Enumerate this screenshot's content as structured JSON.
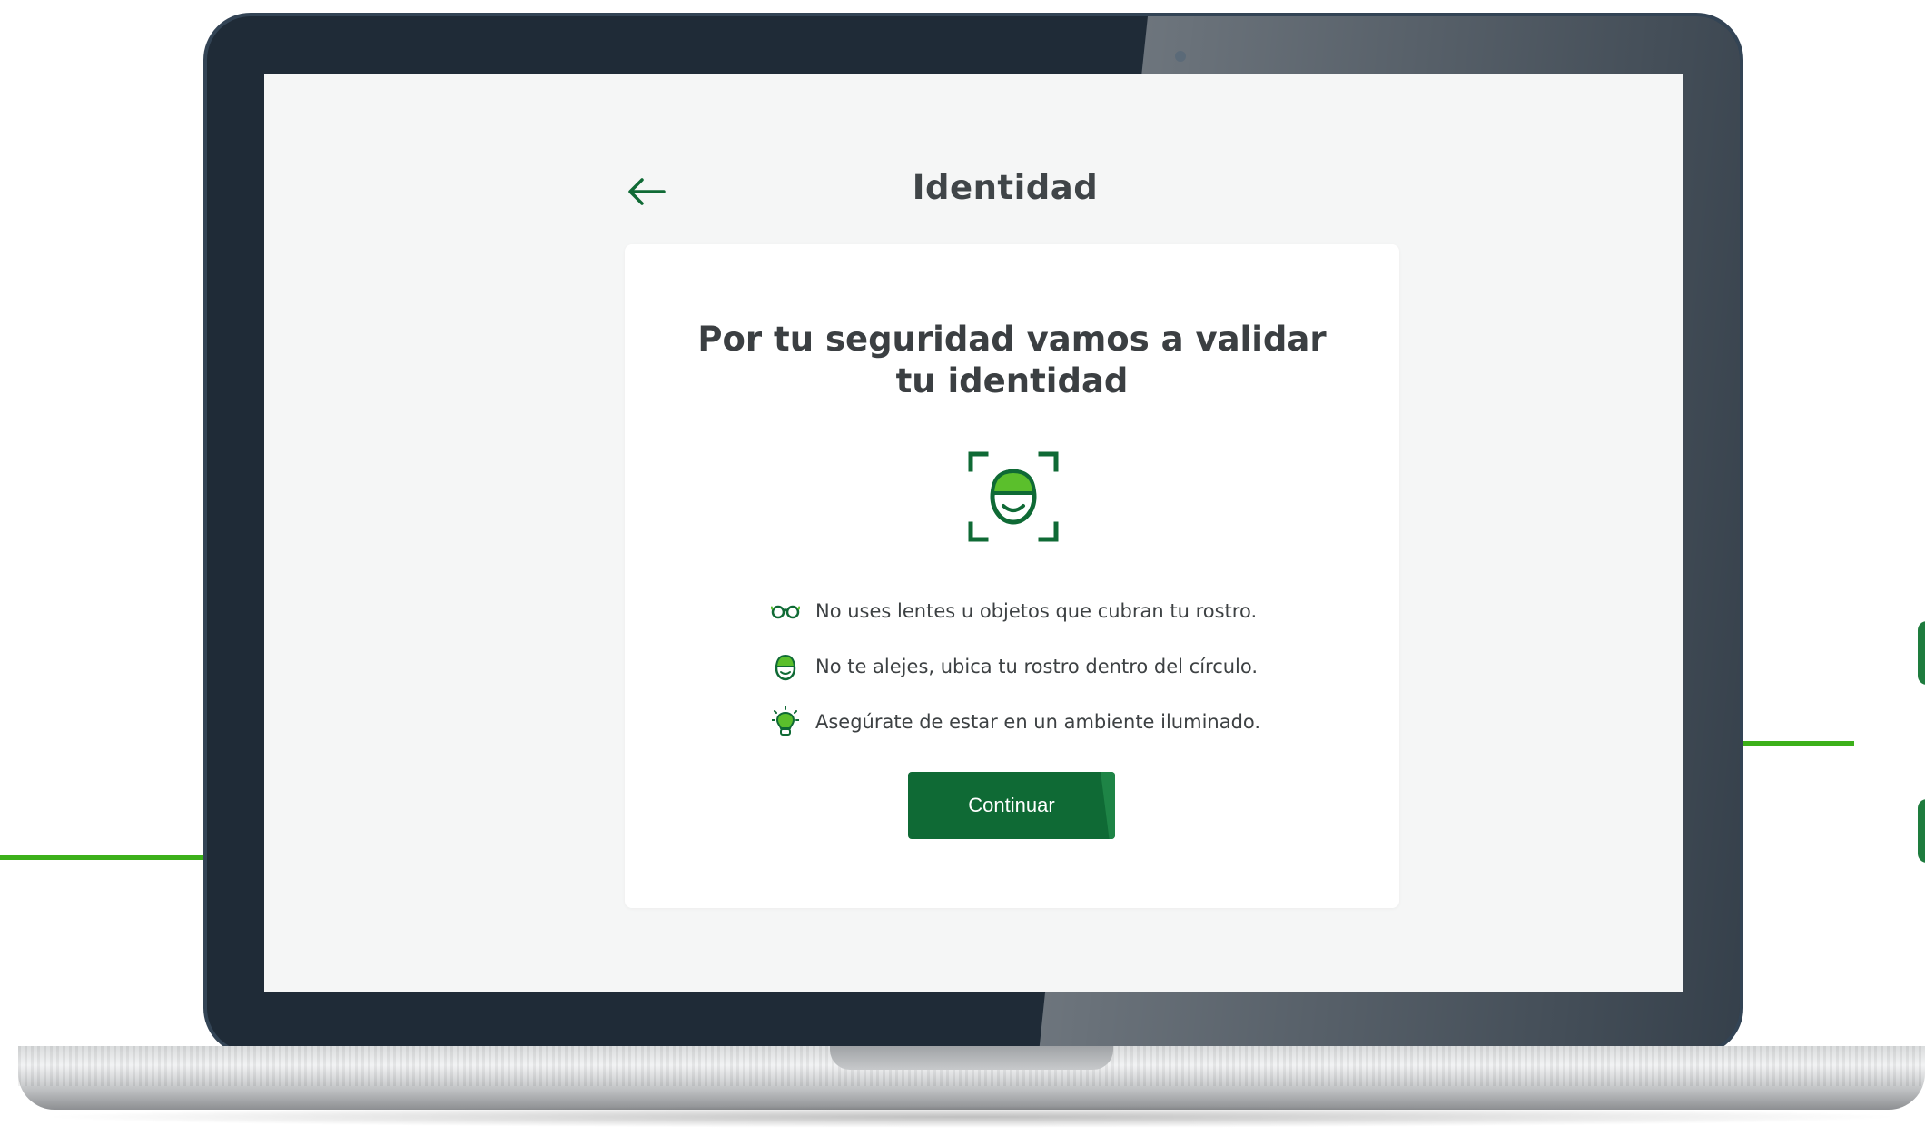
{
  "header": {
    "title": "Identidad"
  },
  "card": {
    "heading": "Por tu seguridad vamos a validar tu identidad",
    "tips": [
      {
        "icon": "glasses-icon",
        "text": "No uses lentes u objetos que cubran tu rostro."
      },
      {
        "icon": "face-circle-icon",
        "text": "No te alejes, ubica tu rostro dentro del círculo."
      },
      {
        "icon": "lightbulb-icon",
        "text": "Asegúrate de estar en un ambiente iluminado."
      }
    ],
    "continue_label": "Continuar"
  },
  "colors": {
    "brand_green": "#0f6a35",
    "accent_green": "#3cb01a",
    "screen_bg": "#f5f6f6",
    "bezel": "#1f2b37"
  }
}
